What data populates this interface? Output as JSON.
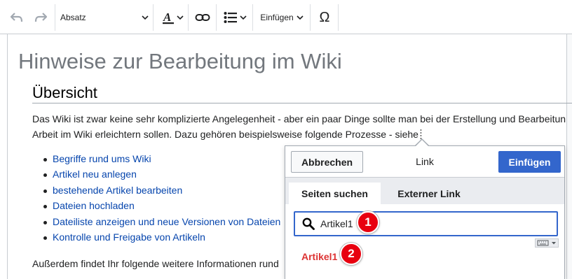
{
  "toolbar": {
    "paragraph_format": "Absatz",
    "insert_menu": "Einfügen",
    "special_char": "Ω"
  },
  "page": {
    "title": "Hinweise zur Bearbeitung im Wiki",
    "section_heading": "Übersicht",
    "intro_line1": "Das Wiki ist zwar keine sehr komplizierte Angelegenheit - aber ein paar Dinge sollte man bei der Erstellung und Bearbeitun",
    "intro_line2": "Arbeit im Wiki erleichtern sollen. Dazu gehören beispielsweise folgende Prozesse - siehe",
    "links": [
      "Begriffe rund ums Wiki",
      "Artikel neu anlegen",
      "bestehende Artikel bearbeiten",
      "Dateien hochladen",
      "Dateiliste anzeigen und neue Versionen von Dateien",
      "Kontrolle und Freigabe von Artikeln"
    ],
    "outro_line": "Außerdem findet Ihr folgende weitere Informationen rund"
  },
  "link_dialog": {
    "cancel_label": "Abbrechen",
    "title": "Link",
    "insert_label": "Einfügen",
    "tabs": [
      "Seiten suchen",
      "Externer Link"
    ],
    "search_value": "Artikel1",
    "result": "Artikel1"
  },
  "annotations": {
    "badge1": "1",
    "badge2": "2"
  },
  "colors": {
    "link": "#0645ad",
    "primary_button": "#3366cc",
    "result_red": "#d33",
    "badge_red": "#e8000f"
  }
}
